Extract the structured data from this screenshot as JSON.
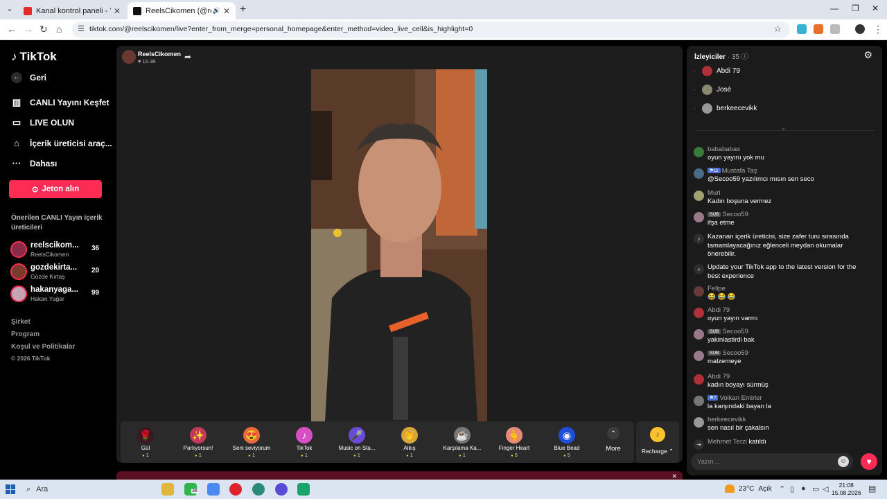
{
  "browser": {
    "tabs": [
      {
        "title": "Kanal kontrol paneli - YouTube"
      },
      {
        "title": "ReelsCikomen (@reelscikomen)"
      }
    ],
    "url": "tiktok.com/@reelscikomen/live?enter_from_merge=personal_homepage&enter_method=video_live_cell&is_highlight=0"
  },
  "sidebar": {
    "logo": "TikTok",
    "back": "Geri",
    "nav": [
      {
        "label": "CANLI Yayını Keşfet",
        "icon": "live-explore-icon"
      },
      {
        "label": "LIVE OLUN",
        "icon": "camera-icon"
      },
      {
        "label": "İçerik üreticisi araç...",
        "icon": "creator-tools-icon"
      },
      {
        "label": "Dahası",
        "icon": "more-dots-icon"
      }
    ],
    "jeton_button": "Jeton alın",
    "recommended_title": "Önerilen CANLI Yayın içerik üreticileri",
    "creators": [
      {
        "name": "reelscikom...",
        "handle": "ReelsCikomen",
        "count": "36",
        "color": "#8a2a4a"
      },
      {
        "name": "gozdekirta...",
        "handle": "Gözde Kırtaş",
        "count": "20",
        "color": "#7a3b2a"
      },
      {
        "name": "hakanyaga...",
        "handle": "Hakan Yağar",
        "count": "99",
        "color": "#c7a4b5"
      }
    ],
    "footer": [
      "Şirket",
      "Program",
      "Koşul ve Politikalar"
    ],
    "copyright": "© 2026 TikTok"
  },
  "live": {
    "host_name": "ReelsCikomen",
    "likes": "15.3K"
  },
  "gifts": [
    {
      "name": "Gül",
      "price": "1",
      "icon": "rose-icon",
      "glyph": "🌹",
      "bg": "#3a1a1e"
    },
    {
      "name": "Parlıyorsun!",
      "price": "1",
      "icon": "youre-awesome-icon",
      "glyph": "✨",
      "bg": "#c23a5b"
    },
    {
      "name": "Seni seviyorum",
      "price": "1",
      "icon": "heart-face-icon",
      "glyph": "😍",
      "bg": "#e86a3c"
    },
    {
      "name": "TikTok",
      "price": "1",
      "icon": "tiktok-gift-icon",
      "glyph": "♪",
      "bg": "#d64fc4"
    },
    {
      "name": "Music on Sta...",
      "price": "1",
      "icon": "music-stage-icon",
      "glyph": "🎤",
      "bg": "#6a4ad8"
    },
    {
      "name": "Alkış",
      "price": "1",
      "icon": "clapping-icon",
      "glyph": "👏",
      "bg": "#d8a53a"
    },
    {
      "name": "Karşılama Ka...",
      "price": "1",
      "icon": "welcome-icon",
      "glyph": "☕",
      "bg": "#777777"
    },
    {
      "name": "Finger Heart",
      "price": "5",
      "icon": "finger-heart-icon",
      "glyph": "🫰",
      "bg": "#e88a7a"
    },
    {
      "name": "Blue Bead",
      "price": "5",
      "icon": "blue-bead-icon",
      "glyph": "◉",
      "bg": "#1f4fd8"
    }
  ],
  "more_label": "More",
  "recharge_label": "Recharge",
  "chat": {
    "viewers_title": "İzleyiciler",
    "viewers_count": "· 35",
    "top_viewers": [
      {
        "name": "Abdi 79",
        "color": "#b0303a"
      },
      {
        "name": "José",
        "color": "#8a8a70"
      },
      {
        "name": "berkeecevikk",
        "color": "#999999"
      }
    ],
    "messages": [
      {
        "user": "babababax",
        "text": "oyun yayını yok mu",
        "badge": "",
        "badge_type": "",
        "color": "#3a7a3a"
      },
      {
        "user": "Mustafa Taş",
        "text": "@Secoo59 yazılımcı mısın sen seco",
        "badge": "11",
        "badge_type": "lvl",
        "color": "#4a6a8a"
      },
      {
        "user": "Muri",
        "text": "Kadın boşuna vermez",
        "badge": "",
        "badge_type": "",
        "color": "#a0a070"
      },
      {
        "user": "Secoo59",
        "text": "ifşa etme",
        "badge": "SUB",
        "badge_type": "sub",
        "color": "#9a7a8a"
      },
      {
        "user": "Felipe",
        "text": "😂 😂 😂",
        "badge": "",
        "badge_type": "",
        "color": "#6a3a3a"
      },
      {
        "user": "Abdi 79",
        "text": "oyun yayın varmı",
        "badge": "",
        "badge_type": "",
        "color": "#b0303a"
      },
      {
        "user": "Secoo59",
        "text": "yakinlastirdi bak",
        "badge": "SUB",
        "badge_type": "sub",
        "color": "#9a7a8a"
      },
      {
        "user": "Secoo59",
        "text": "malzemeye",
        "badge": "SUB",
        "badge_type": "sub",
        "color": "#9a7a8a"
      },
      {
        "user": "Abdi 79",
        "text": "kadın boyayı sürmüş",
        "badge": "",
        "badge_type": "",
        "color": "#b0303a"
      },
      {
        "user": "Volkan Emirler",
        "text": "la karşındaki bayan la",
        "badge": "7",
        "badge_type": "lvl",
        "color": "#777777"
      },
      {
        "user": "berkeecevikk",
        "text": "sen nasıl bir çakalsın",
        "badge": "",
        "badge_type": "",
        "color": "#999999"
      }
    ],
    "system_messages": [
      "Kazanan içerik üreticisi, size zafer turu sırasında tamamlayacağınız eğlenceli meydan okumalar önerebilir.",
      "Update your TikTok app to the latest version for the best experience"
    ],
    "joined": {
      "user": "Mehmet Terzi",
      "text": "katıldı"
    },
    "input_placeholder": "Yazın..."
  },
  "taskbar": {
    "search": "Ara",
    "badge": "38",
    "weather": "23°C",
    "weather_text": "Açık",
    "time": "21:08",
    "date": "15.08.2026"
  }
}
